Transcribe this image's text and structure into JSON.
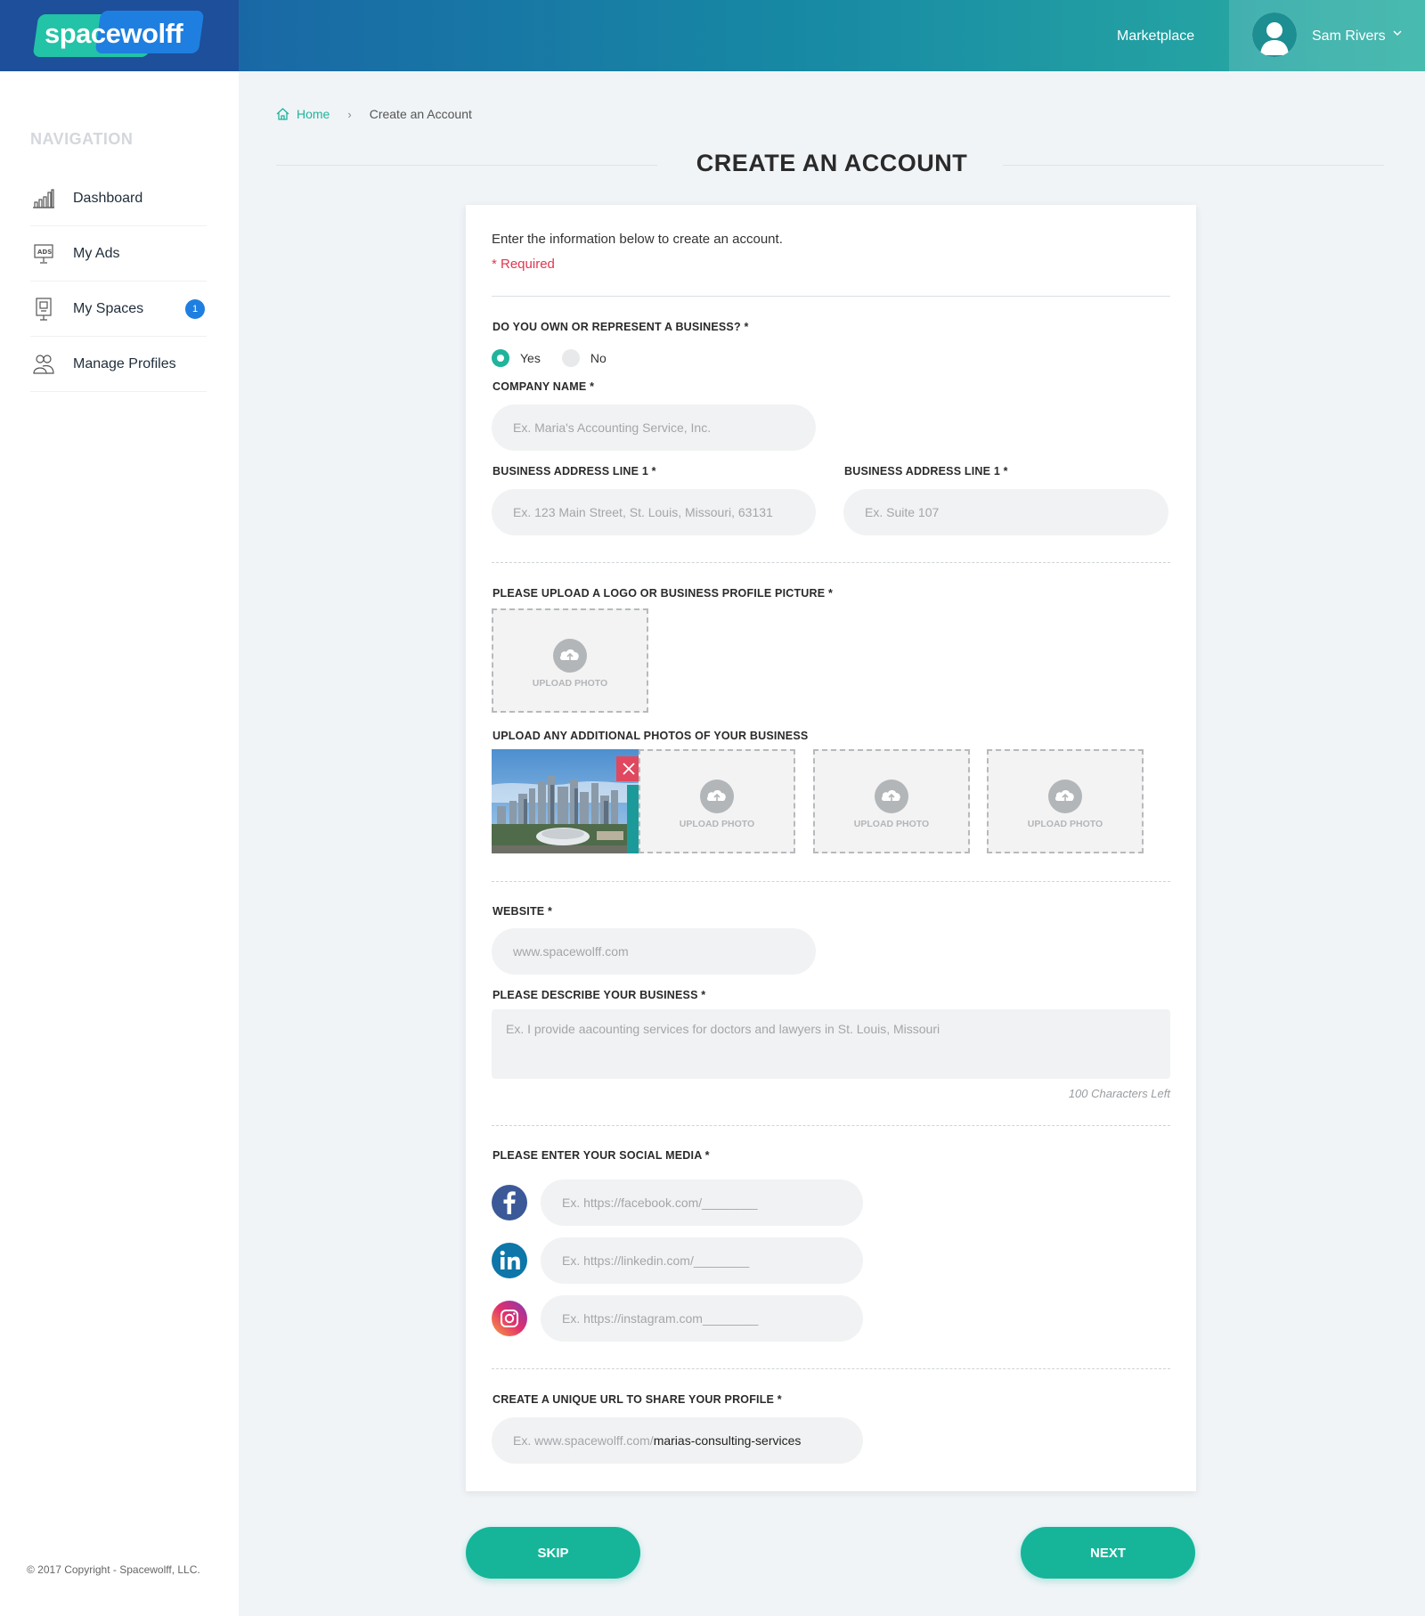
{
  "header": {
    "logo_text": "spacewolff",
    "marketplace_label": "Marketplace",
    "user_name": "Sam Rivers"
  },
  "sidebar": {
    "title": "NAVIGATION",
    "items": [
      {
        "label": "Dashboard",
        "icon": "bar-chart-icon"
      },
      {
        "label": "My Ads",
        "icon": "ads-icon"
      },
      {
        "label": "My Spaces",
        "icon": "billboard-icon",
        "badge": "1"
      },
      {
        "label": "Manage Profiles",
        "icon": "profiles-icon"
      }
    ],
    "copyright": "© 2017 Copyright - Spacewolff, LLC."
  },
  "breadcrumb": {
    "home": "Home",
    "separator": "›",
    "current": "Create an Account"
  },
  "page_title": "CREATE AN ACCOUNT",
  "form": {
    "intro": "Enter the information below to create an account.",
    "required_note": "* Required",
    "business_question": "DO YOU OWN OR REPRESENT A BUSINESS? *",
    "radio_yes": "Yes",
    "radio_no": "No",
    "company_label": "COMPANY NAME *",
    "company_placeholder": "Ex. Maria's Accounting Service, Inc.",
    "address1_label": "BUSINESS ADDRESS LINE 1 *",
    "address1_placeholder": "Ex. 123 Main Street, St. Louis, Missouri, 63131",
    "address2_label": "BUSINESS ADDRESS LINE 1 *",
    "address2_placeholder": "Ex. Suite 107",
    "logo_label": "PLEASE UPLOAD A LOGO OR BUSINESS PROFILE PICTURE *",
    "upload_text": "UPLOAD PHOTO",
    "additional_label": "UPLOAD ANY ADDITIONAL PHOTOS OF YOUR BUSINESS",
    "website_label": "WEBSITE *",
    "website_placeholder": "www.spacewolff.com",
    "describe_label": "PLEASE DESCRIBE YOUR BUSINESS *",
    "describe_placeholder": "Ex. I provide aacounting services for doctors and lawyers in St. Louis, Missouri",
    "chars_left": "100 Characters Left",
    "social_label": "PLEASE ENTER YOUR SOCIAL MEDIA *",
    "facebook_placeholder": "Ex. https://facebook.com/________",
    "linkedin_placeholder": "Ex. https://linkedin.com/________",
    "instagram_placeholder": "Ex. https://instagram.com________",
    "url_label": "CREATE A UNIQUE URL TO SHARE YOUR PROFILE *",
    "url_prefix": "Ex. www.spacewolff.com/",
    "url_value": "marias-consulting-services"
  },
  "buttons": {
    "skip": "SKIP",
    "next": "NEXT"
  },
  "colors": {
    "accent": "#16b59a",
    "brand_blue": "#1e7fe0",
    "required_red": "#e0364f"
  }
}
